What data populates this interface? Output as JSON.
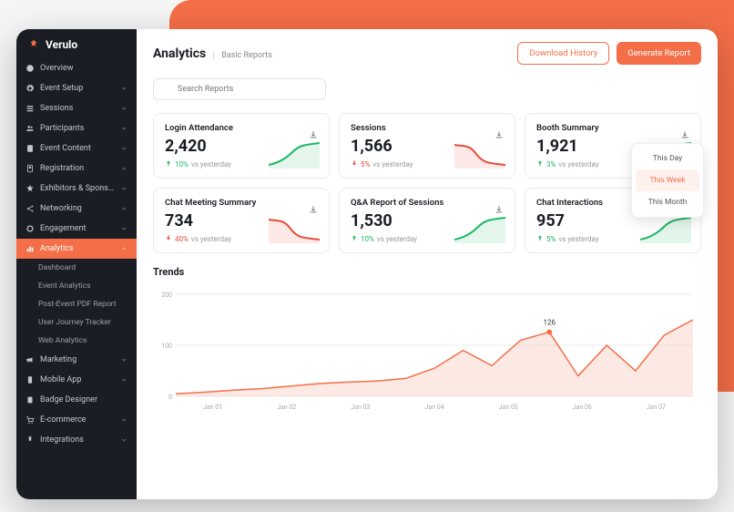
{
  "brand": "Verulo",
  "header": {
    "title": "Analytics",
    "subtitle": "Basic Reports",
    "btn_download": "Download History",
    "btn_generate": "Generate Report"
  },
  "search": {
    "placeholder": "Search Reports"
  },
  "sidebar": {
    "items": [
      {
        "icon": "info",
        "label": "Overview",
        "expand": false
      },
      {
        "icon": "gear",
        "label": "Event Setup",
        "expand": true
      },
      {
        "icon": "list",
        "label": "Sessions",
        "expand": true
      },
      {
        "icon": "users",
        "label": "Participants",
        "expand": true
      },
      {
        "icon": "doc",
        "label": "Event Content",
        "expand": true
      },
      {
        "icon": "badge",
        "label": "Registration",
        "expand": true
      },
      {
        "icon": "star",
        "label": "Exhibitors & Sponsors",
        "expand": true
      },
      {
        "icon": "share",
        "label": "Networking",
        "expand": true
      },
      {
        "icon": "ring",
        "label": "Engagement",
        "expand": true
      },
      {
        "icon": "bars",
        "label": "Analytics",
        "expand": true,
        "active": true
      },
      {
        "icon": "mega",
        "label": "Marketing",
        "expand": true
      },
      {
        "icon": "phone",
        "label": "Mobile App",
        "expand": true
      },
      {
        "icon": "badge2",
        "label": "Badge Designer",
        "expand": false
      },
      {
        "icon": "cart",
        "label": "E-commerce",
        "expand": true
      },
      {
        "icon": "plug",
        "label": "Integrations",
        "expand": true
      }
    ],
    "analytics_sub": [
      "Dashboard",
      "Event Analytics",
      "Post-Event PDF Report",
      "User Journey Tracker",
      "Web Analytics"
    ]
  },
  "cards": [
    {
      "title": "Login Attendance",
      "value": "2,420",
      "dir": "up",
      "pct": "10%",
      "vs": "vs yesterday",
      "spark": "green"
    },
    {
      "title": "Sessions",
      "value": "1,566",
      "dir": "down",
      "pct": "5%",
      "vs": "vs yesterday",
      "spark": "red"
    },
    {
      "title": "Booth Summary",
      "value": "1,921",
      "dir": "up",
      "pct": "3%",
      "vs": "vs yesterday",
      "spark": "green"
    },
    {
      "title": "Chat Meeting Summary",
      "value": "734",
      "dir": "down",
      "pct": "40%",
      "vs": "vs yesterday",
      "spark": "red"
    },
    {
      "title": "Q&A Report of Sessions",
      "value": "1,530",
      "dir": "up",
      "pct": "10%",
      "vs": "vs yesterday",
      "spark": "green"
    },
    {
      "title": "Chat Interactions",
      "value": "957",
      "dir": "up",
      "pct": "5%",
      "vs": "vs yesterday",
      "spark": "green"
    }
  ],
  "period": {
    "options": [
      "This Day",
      "This Week",
      "This Month"
    ],
    "selected": 1
  },
  "trends_title": "Trends",
  "chart_data": {
    "type": "area",
    "title": "Trends",
    "xlabel": "",
    "ylabel": "",
    "ylim": [
      0,
      200
    ],
    "yticks": [
      0,
      100,
      200
    ],
    "categories": [
      "Jan 01",
      "Jan 02",
      "Jan 03",
      "Jan 04",
      "Jan 05",
      "Jan 06",
      "Jan 07"
    ],
    "values": [
      5,
      8,
      12,
      15,
      20,
      25,
      28,
      30,
      35,
      55,
      90,
      60,
      110,
      126,
      40,
      100,
      50,
      120,
      150
    ],
    "peak_label": "126",
    "peak_index": 13,
    "grid": true
  },
  "colors": {
    "accent": "#f46e47",
    "green": "#1fb866",
    "red": "#e74c3c"
  }
}
